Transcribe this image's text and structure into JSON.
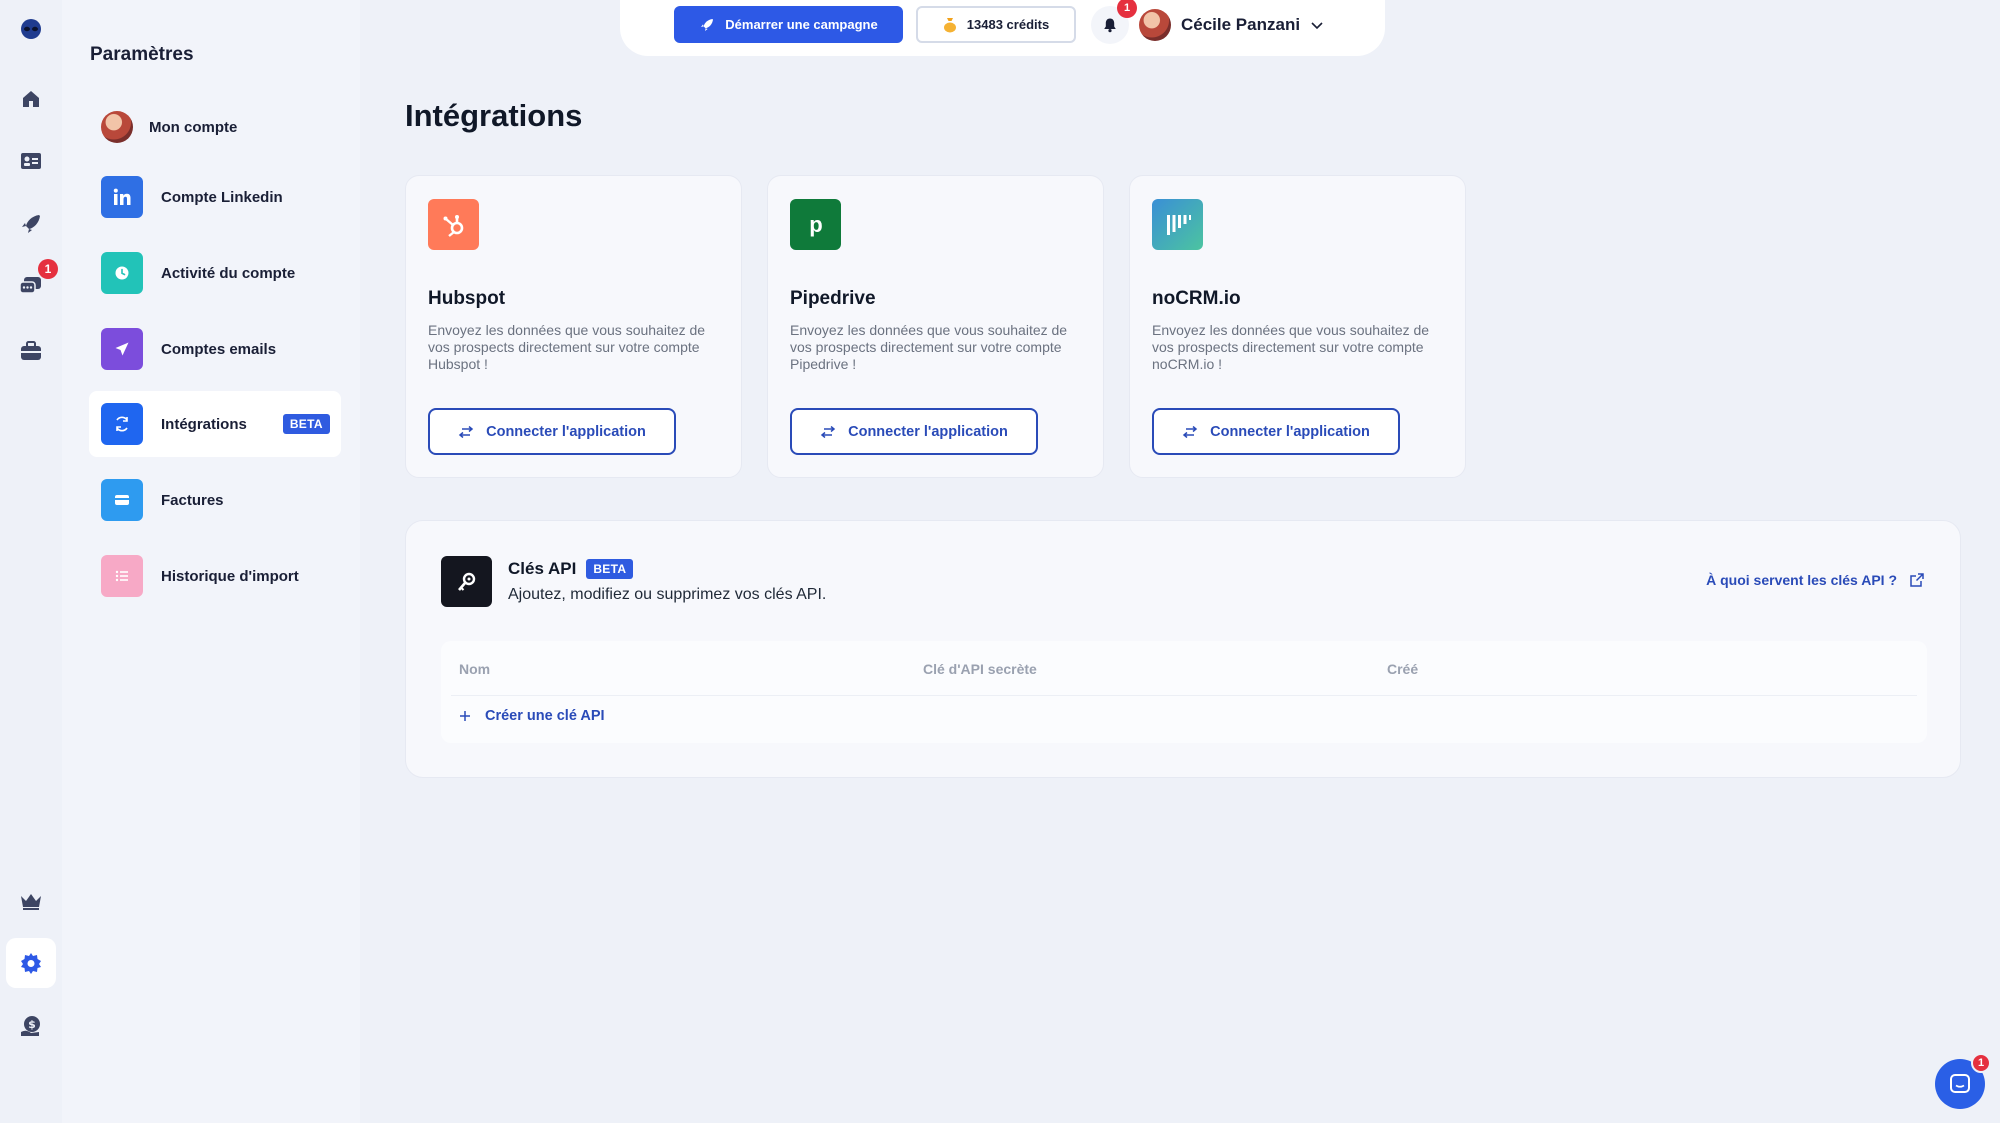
{
  "rail": {
    "items": [
      {
        "name": "alien-logo-icon"
      },
      {
        "name": "home-icon"
      },
      {
        "name": "contacts-icon"
      },
      {
        "name": "rocket-icon"
      },
      {
        "name": "messages-icon",
        "badge": "1"
      },
      {
        "name": "briefcase-icon"
      },
      {
        "name": "crown-icon"
      },
      {
        "name": "settings-icon"
      },
      {
        "name": "money-icon"
      }
    ]
  },
  "settings": {
    "title": "Paramètres",
    "items": [
      {
        "label": "Mon compte",
        "icon": "user-avatar-icon"
      },
      {
        "label": "Compte Linkedin",
        "icon": "linkedin-icon",
        "color": "#2f6fe4"
      },
      {
        "label": "Activité du compte",
        "icon": "clock-icon",
        "color": "#22c3b8"
      },
      {
        "label": "Comptes emails",
        "icon": "paper-plane-icon",
        "color": "#7c4ddc"
      },
      {
        "label": "Intégrations",
        "icon": "refresh-icon",
        "color": "#1f66f0",
        "badge": "BETA"
      },
      {
        "label": "Factures",
        "icon": "card-icon",
        "color": "#2e9bf0"
      },
      {
        "label": "Historique d'import",
        "icon": "list-icon",
        "color": "#f7a9c6"
      }
    ]
  },
  "topbar": {
    "campaign_label": "Démarrer une campagne",
    "credits_label": "13483 crédits",
    "notification_count": "1",
    "user_name": "Cécile Panzani"
  },
  "main": {
    "title": "Intégrations",
    "integrations": [
      {
        "name": "Hubspot",
        "description": "Envoyez les données que vous souhaitez de vos prospects directement sur votre compte Hubspot !",
        "button": "Connecter l'application",
        "color": "#ff7a59"
      },
      {
        "name": "Pipedrive",
        "description": "Envoyez les données que vous souhaitez de vos prospects directement sur votre compte Pipedrive !",
        "button": "Connecter l'application",
        "color": "#0f7a3a"
      },
      {
        "name": "noCRM.io",
        "description": "Envoyez les données que vous souhaitez de vos prospects directement sur votre compte noCRM.io !",
        "button": "Connecter l'application",
        "color": "#3fb6a8"
      }
    ],
    "api": {
      "title": "Clés API",
      "badge": "BETA",
      "subtitle": "Ajoutez, modifiez ou supprimez vos clés API.",
      "help_link": "À quoi servent les clés API ?",
      "columns": [
        "Nom",
        "Clé d'API secrète",
        "Créé"
      ],
      "create_label": "Créer une clé API"
    }
  },
  "chat": {
    "badge": "1"
  },
  "colors": {
    "accent": "#2d59e6",
    "link": "#2a4bb8",
    "badge": "#e5303f"
  }
}
